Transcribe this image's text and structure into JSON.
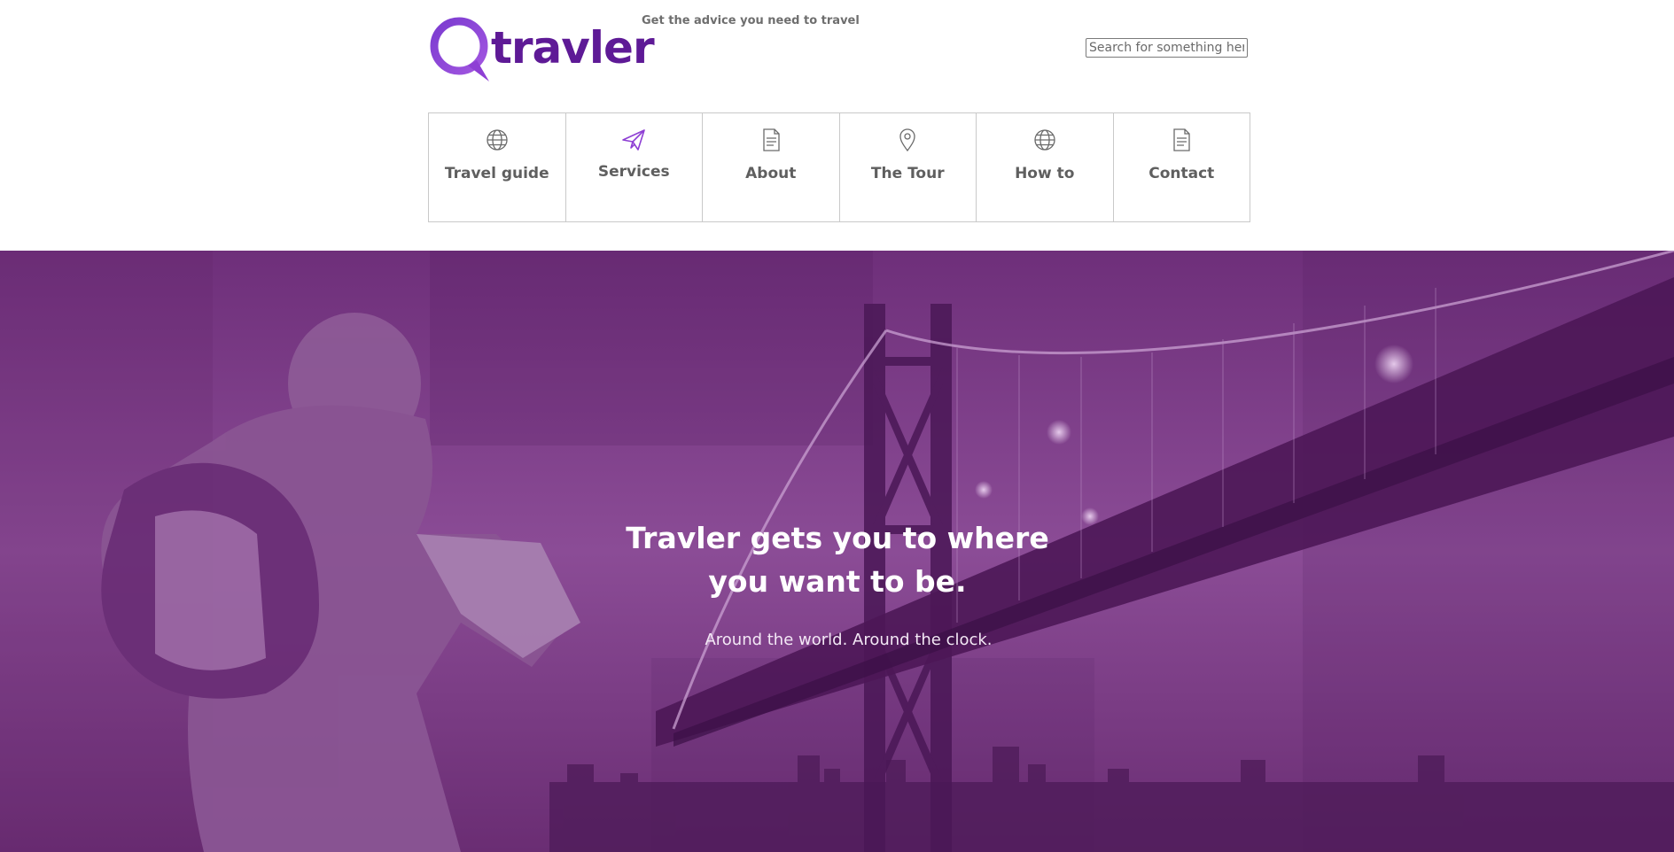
{
  "brand": {
    "logo_text": "travler",
    "tagline": "Get the advice you need to travel",
    "primary_color": "#5e1a96",
    "accent_color": "#8e3fd4"
  },
  "search": {
    "placeholder": "Search for something here",
    "value": ""
  },
  "nav": {
    "items": [
      {
        "label": "Travel guide",
        "icon": "globe-icon",
        "active": false
      },
      {
        "label": "Services",
        "icon": "paper-plane-icon",
        "active": true
      },
      {
        "label": "About",
        "icon": "document-icon",
        "active": false
      },
      {
        "label": "The Tour",
        "icon": "map-pin-icon",
        "active": false
      },
      {
        "label": "How to",
        "icon": "globe-icon",
        "active": false
      },
      {
        "label": "Contact",
        "icon": "document-icon",
        "active": false
      }
    ]
  },
  "hero": {
    "title_line1": "Travler gets you to where",
    "title_line2": "you want to be.",
    "subtitle": "Around the world. Around the clock.",
    "overlay_color": "#7d3a87"
  }
}
